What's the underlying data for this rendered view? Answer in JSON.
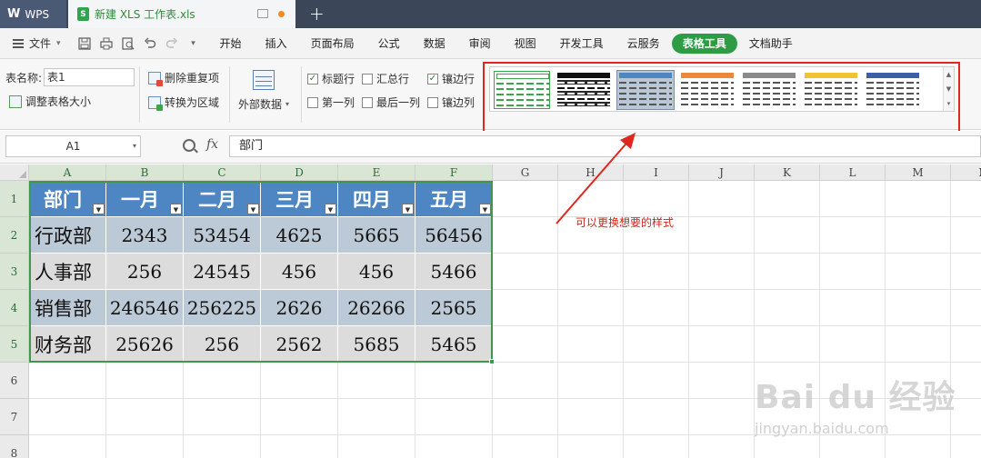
{
  "titlebar": {
    "app_label": "WPS",
    "app_logo": "W",
    "doc_tab_title": "新建 XLS 工作表.xls",
    "xls_icon_glyph": "S",
    "new_tab_glyph": "+"
  },
  "menubar": {
    "file_label": "文件",
    "items": [
      "开始",
      "插入",
      "页面布局",
      "公式",
      "数据",
      "审阅",
      "视图",
      "开发工具",
      "云服务",
      "表格工具",
      "文档助手"
    ],
    "active_item": "表格工具",
    "active_color": "#2e9c45"
  },
  "ribbon": {
    "table_name_label": "表名称:",
    "table_name_value": "表1",
    "resize_table_label": "调整表格大小",
    "remove_duplicates_label": "删除重复项",
    "convert_to_range_label": "转换为区域",
    "external_data_label": "外部数据",
    "checkboxes": {
      "header_row": {
        "label": "标题行",
        "checked": true
      },
      "total_row": {
        "label": "汇总行",
        "checked": false
      },
      "banded_rows": {
        "label": "镶边行",
        "checked": true
      },
      "first_column": {
        "label": "第一列",
        "checked": false
      },
      "last_column": {
        "label": "最后一列",
        "checked": false
      },
      "banded_columns": {
        "label": "镶边列",
        "checked": false
      }
    },
    "check_glyph": "✓",
    "style_swatches": [
      {
        "name": "green-outline",
        "color": "#3aa54a",
        "selected": false
      },
      {
        "name": "black",
        "color": "#111111",
        "selected": false
      },
      {
        "name": "blue-gray",
        "color": "#4e86c4",
        "selected": true
      },
      {
        "name": "orange",
        "color": "#e8893c",
        "selected": false
      },
      {
        "name": "gray",
        "color": "#8a8a8a",
        "selected": false
      },
      {
        "name": "yellow",
        "color": "#f2c230",
        "selected": false
      },
      {
        "name": "blue",
        "color": "#3e5fa8",
        "selected": false
      }
    ],
    "scroll_glyphs": [
      "▲",
      "▼",
      "▾"
    ]
  },
  "formula_bar": {
    "cell_ref": "A1",
    "fx_label": "fx",
    "formula_value": "部门",
    "dropdown_glyph": "▾"
  },
  "sheet": {
    "columns": [
      "A",
      "B",
      "C",
      "D",
      "E",
      "F",
      "G",
      "H",
      "I",
      "J",
      "K",
      "L",
      "M",
      "N"
    ],
    "rows": [
      "1",
      "2",
      "3",
      "4",
      "5",
      "6",
      "7",
      "8"
    ],
    "table": {
      "headers": [
        "部门",
        "一月",
        "二月",
        "三月",
        "四月",
        "五月"
      ],
      "rows": [
        [
          "行政部",
          "2343",
          "53454",
          "4625",
          "5665",
          "56456"
        ],
        [
          "人事部",
          "256",
          "24545",
          "456",
          "456",
          "5466"
        ],
        [
          "销售部",
          "246546",
          "256225",
          "2626",
          "26266",
          "2565"
        ],
        [
          "财务部",
          "25626",
          "256",
          "2562",
          "5685",
          "5465"
        ]
      ],
      "header_color": "#4e86c4",
      "band_color_a": "#bcc9d6",
      "band_color_b": "#dcdcdc",
      "filter_glyph": "▼"
    }
  },
  "annotation": {
    "text": "可以更换想要的样式",
    "color": "#d0231a"
  },
  "watermark": {
    "main": "Bai du 经验",
    "sub": "jingyan.baidu.com"
  }
}
